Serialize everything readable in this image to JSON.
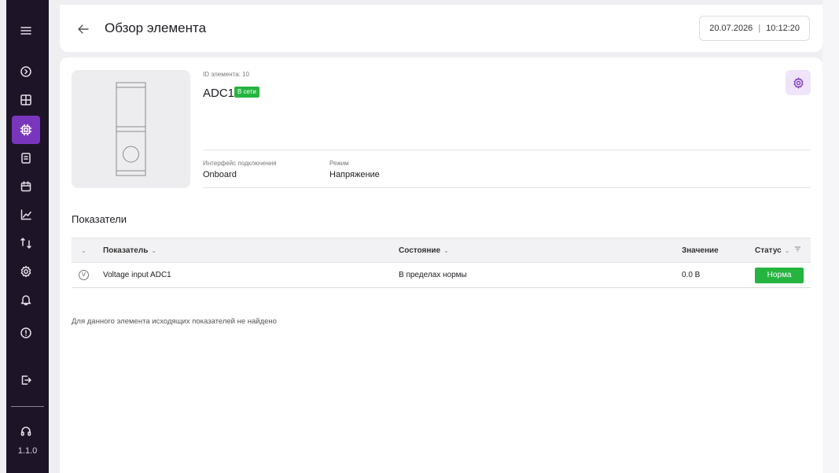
{
  "header": {
    "title": "Обзор элемента",
    "date": "20.07.2026",
    "separator": "|",
    "time": "10:12:20"
  },
  "sidebar": {
    "items": [
      {
        "name": "menu-icon",
        "active": false
      },
      {
        "name": "circle-chevron-icon",
        "active": false
      },
      {
        "name": "dashboard-icon",
        "active": false
      },
      {
        "name": "chip-icon",
        "active": true
      },
      {
        "name": "document-icon",
        "active": false
      },
      {
        "name": "calendar-icon",
        "active": false
      },
      {
        "name": "chart-icon",
        "active": false
      },
      {
        "name": "sync-icon",
        "active": false
      },
      {
        "name": "gear-icon",
        "active": false
      },
      {
        "name": "bell-icon",
        "active": false
      },
      {
        "name": "alert-icon",
        "active": false
      },
      {
        "name": "logout-icon",
        "active": false
      },
      {
        "name": "headset-icon",
        "active": false
      }
    ],
    "version": "1.1.0",
    "active_color": "#7a35bd",
    "background_color": "#1e1427"
  },
  "device": {
    "id_label": "ID элемента: 10",
    "name": "ADC1",
    "status": "В сети",
    "status_color": "#26b440",
    "properties": [
      {
        "label": "Интерфейс подключения",
        "value": "Onboard"
      },
      {
        "label": "Режим",
        "value": "Напряжение"
      }
    ]
  },
  "indicators": {
    "title": "Показатели",
    "columns": {
      "indicator": "Показатель",
      "state": "Состояние",
      "value": "Значение",
      "status": "Статус"
    },
    "rows": [
      {
        "icon_letter": "V",
        "indicator": "Voltage input ADC1",
        "state": "В пределах нормы",
        "value": "0.0 В",
        "status": "Норма"
      }
    ],
    "empty_message": "Для данного элемента исходящих показателей не найдено"
  }
}
